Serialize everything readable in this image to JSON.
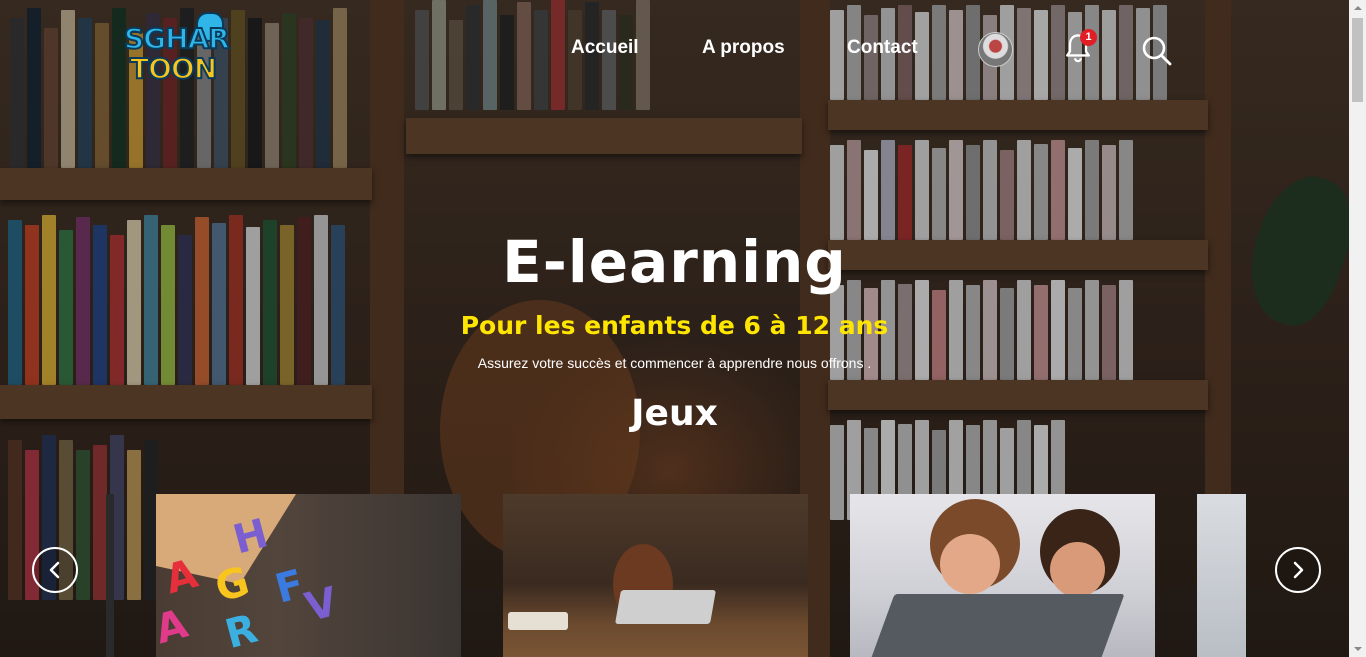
{
  "brand": {
    "line1": "SGHAR",
    "line2": "TOON"
  },
  "nav": {
    "links": [
      "Accueil",
      "A propos",
      "Contact"
    ],
    "notification_count": "1"
  },
  "hero": {
    "title": "E-learning",
    "subtitle": "Pour les enfants de 6 à 12 ans",
    "tagline": "Assurez votre succès et commencer à apprendre nous offrons .",
    "section_title": "Jeux"
  },
  "carousel": {
    "cards": [
      "letters-toys",
      "girl-laptop-library",
      "kids-laptop",
      "partial-card"
    ],
    "prev_icon": "chevron-left-icon",
    "next_icon": "chevron-right-icon"
  },
  "colors": {
    "accent_yellow": "#ffe600",
    "badge_red": "#e01e25",
    "logo_blue": "#2fb5e8",
    "logo_yellow": "#f7c51e"
  }
}
